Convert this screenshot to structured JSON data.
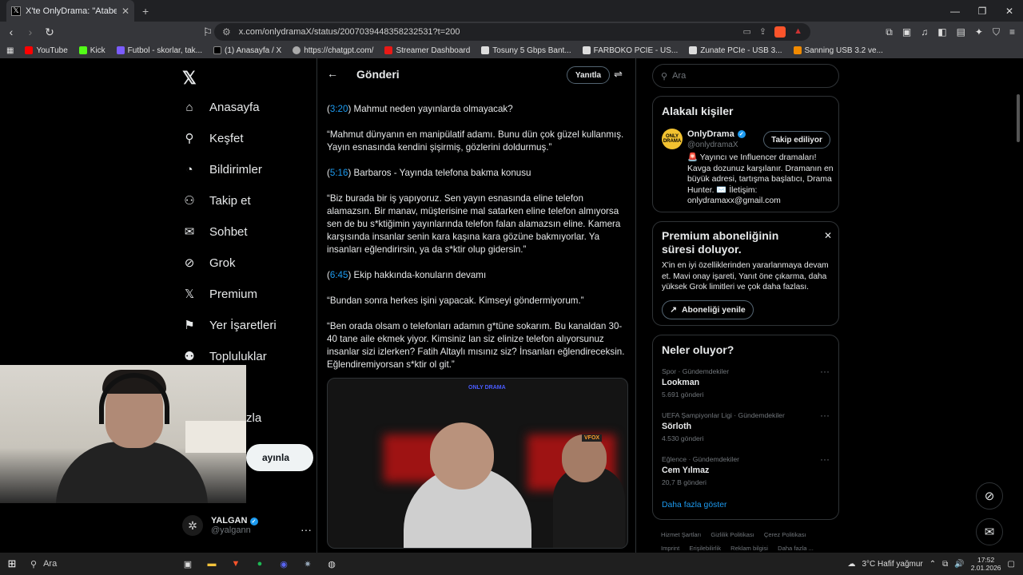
{
  "browser": {
    "tab_title": "X'te OnlyDrama: \"Ataberk Do",
    "tab_icon": "x-logo-icon",
    "url": "x.com/onlydramaX/status/2007039448358232531?t=200",
    "bookmarks": [
      {
        "label": "YouTube",
        "color": "#ff0000"
      },
      {
        "label": "Kick",
        "color": "#53fc18"
      },
      {
        "label": "Futbol - skorlar, tak...",
        "color": "#7b5cff"
      },
      {
        "label": "(1) Anasayfa / X",
        "color": "#000000"
      },
      {
        "label": "https://chatgpt.com/",
        "color": "#aaaaaa"
      },
      {
        "label": "Streamer Dashboard",
        "color": "#e91916"
      },
      {
        "label": "Tosuny 5 Gbps Bant...",
        "color": "#dddddd"
      },
      {
        "label": "FARBOKO PCIE - US...",
        "color": "#dddddd"
      },
      {
        "label": "Zunate PCIe - USB 3...",
        "color": "#dddddd"
      },
      {
        "label": "Sanning USB 3.2 ve...",
        "color": "#f08a00"
      }
    ]
  },
  "nav": {
    "items": [
      {
        "label": "Anasayfa",
        "icon": "home-icon"
      },
      {
        "label": "Keşfet",
        "icon": "search-icon"
      },
      {
        "label": "Bildirimler",
        "icon": "bell-icon"
      },
      {
        "label": "Takip et",
        "icon": "add-user-icon"
      },
      {
        "label": "Sohbet",
        "icon": "mail-icon"
      },
      {
        "label": "Grok",
        "icon": "grok-icon"
      },
      {
        "label": "Premium",
        "icon": "x-logo-icon"
      },
      {
        "label": "Yer İşaretleri",
        "icon": "bookmark-icon"
      },
      {
        "label": "Topluluklar",
        "icon": "community-icon"
      }
    ],
    "more_partial": "zla",
    "post_partial": "ayınla",
    "account": {
      "name": "YALGAN",
      "handle": "@yalgann"
    }
  },
  "post": {
    "header_title": "Gönderi",
    "reply_label": "Yanıtla",
    "paragraphs": [
      {
        "ts": "3:20",
        "pre": "(",
        "post": ") Mahmut neden yayınlarda olmayacak?"
      },
      {
        "text": "“Mahmut dünyanın en manipülatif adamı. Bunu dün çok güzel kullanmış. Yayın esnasında kendini şişirmiş, gözlerini doldurmuş.”"
      },
      {
        "ts": "5:16",
        "pre": "(",
        "post": ") Barbaros - Yayında telefona bakma konusu"
      },
      {
        "text": "“Biz burada bir iş yapıyoruz. Sen yayın esnasında eline telefon alamazsın. Bir manav, müşterisine mal satarken eline telefon almıyorsa sen de bu s*ktiğimin yayınlarında telefon falan alamazsın eline. Kamera karşısında insanlar senin kara kaşına kara gözüne bakmıyorlar. Ya insanları eğlendirirsin, ya da s*ktir olup gidersin.”"
      },
      {
        "ts": "6:45",
        "pre": "(",
        "post": ") Ekip hakkında-konuların devamı"
      },
      {
        "text": "“Bundan sonra herkes işini yapacak. Kimseyi göndermiyorum.”"
      },
      {
        "text": "“Ben orada olsam o telefonları adamın g*tüne sokarım. Bu kanaldan 30-40 tane aile ekmek yiyor. Kimsiniz lan siz elinize telefon alıyorsunuz insanlar sizi izlerken? Fatih Altaylı mısınız siz? İnsanları eğlendireceksin. Eğlendiremiyorsan s*ktir ol git.”"
      }
    ],
    "video_logo": "ONLY DRAMA",
    "video_tag": "VFOX"
  },
  "sidebar": {
    "search_placeholder": "Ara",
    "people": {
      "title": "Alakalı kişiler",
      "name": "OnlyDrama",
      "handle": "@onlydramaX",
      "avatar_text": "ONLY DRAMA",
      "follow_label": "Takip ediliyor",
      "bio": "🚨 Yayıncı ve Influencer dramaları! Kavga dozunuz karşılanır. Dramanın en büyük adresi, tartışma başlatıcı, Drama Hunter. ✉️ İletişim: onlydramaxx@gmail.com"
    },
    "premium": {
      "title": "Premium aboneliğinin süresi doluyor.",
      "desc": "X'in en iyi özelliklerinden yararlanmaya devam et. Mavi onay işareti, Yanıt öne çıkarma, daha yüksek Grok limitleri ve çok daha fazlası.",
      "button": "Aboneliği yenile"
    },
    "trends": {
      "title": "Neler oluyor?",
      "items": [
        {
          "cat": "Spor · Gündemdekiler",
          "name": "Lookman",
          "count": "5.691 gönderi"
        },
        {
          "cat": "UEFA Şampiyonlar Ligi · Gündemdekiler",
          "name": "Sörloth",
          "count": "4.530 gönderi"
        },
        {
          "cat": "Eğlence · Gündemdekiler",
          "name": "Cem Yılmaz",
          "count": "20,7 B gönderi"
        }
      ],
      "show_more": "Daha fazla göster"
    },
    "footer": [
      "Hizmet Şartları",
      "Gizlilik Politikası",
      "Çerez Politikası",
      "Imprint",
      "Erişilebilirlik",
      "Reklam bilgisi",
      "Daha fazla ..."
    ]
  },
  "taskbar": {
    "search": "Ara",
    "weather": "3°C  Hafif yağmur",
    "time": "17:52",
    "date": "2.01.2026"
  }
}
